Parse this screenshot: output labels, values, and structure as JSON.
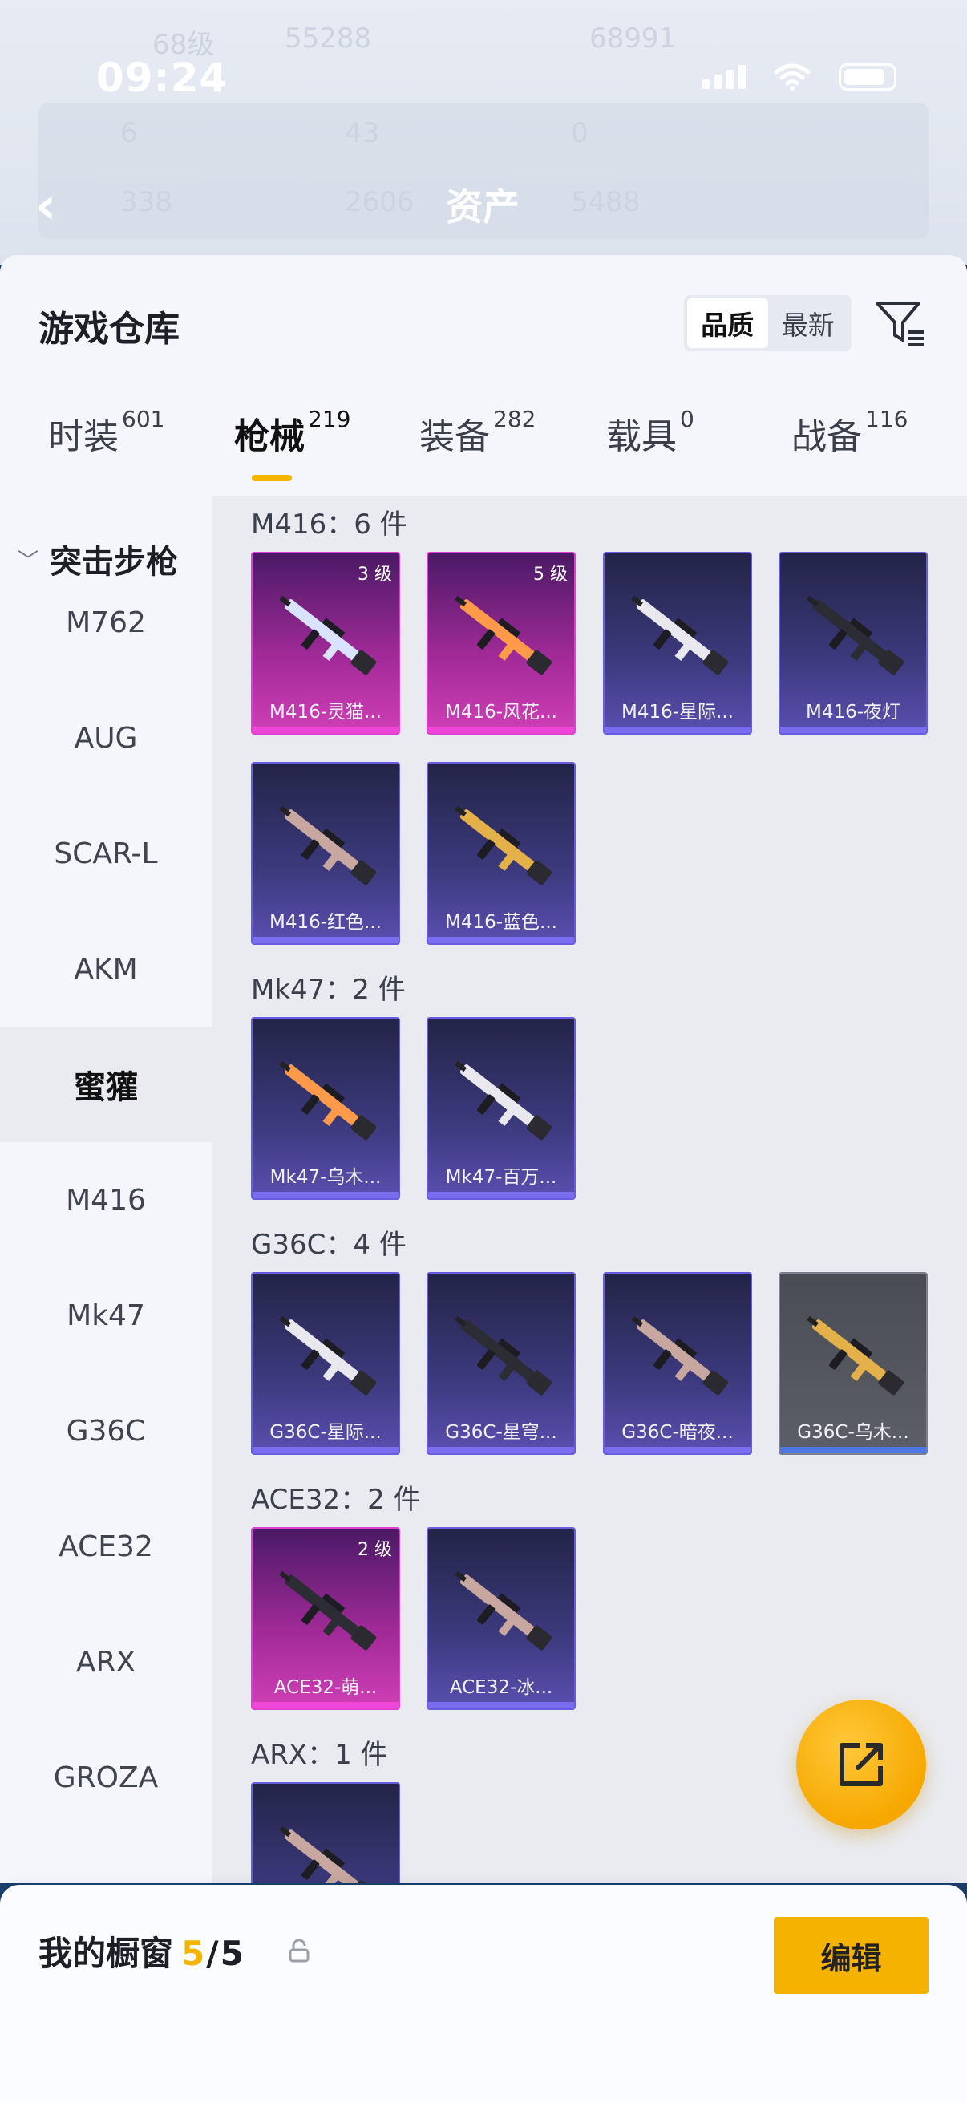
{
  "status_bar": {
    "time": "09:24"
  },
  "background": {
    "title": "资产",
    "ghost_texts": [
      "68级",
      "55288",
      "68991",
      "6",
      "43",
      "0",
      "338",
      "2606",
      "5488"
    ]
  },
  "header": {
    "title": "游戏仓库",
    "sort_options": [
      {
        "label": "品质",
        "active": true
      },
      {
        "label": "最新",
        "active": false
      }
    ],
    "filter_icon": "filter-icon"
  },
  "tabs": [
    {
      "label": "时装",
      "count": "601",
      "active": false
    },
    {
      "label": "枪械",
      "count": "219",
      "active": true
    },
    {
      "label": "装备",
      "count": "282",
      "active": false
    },
    {
      "label": "载具",
      "count": "0",
      "active": false
    },
    {
      "label": "战备",
      "count": "116",
      "active": false
    }
  ],
  "sidebar": {
    "group": "突击步枪",
    "items": [
      "M762",
      "AUG",
      "SCAR-L",
      "AKM",
      "蜜獾",
      "M416",
      "Mk47",
      "G36C",
      "ACE32",
      "ARX",
      "GROZA"
    ],
    "active_item": "蜜獾"
  },
  "sections": [
    {
      "title": "M416：6 件",
      "items": [
        {
          "name": "M416-灵猫...",
          "rarity": "pink",
          "level": "3 级"
        },
        {
          "name": "M416-风花...",
          "rarity": "pink",
          "level": "5 级"
        },
        {
          "name": "M416-星际...",
          "rarity": "purple",
          "level": ""
        },
        {
          "name": "M416-夜灯",
          "rarity": "purple",
          "level": ""
        },
        {
          "name": "M416-红色...",
          "rarity": "purple",
          "level": ""
        },
        {
          "name": "M416-蓝色...",
          "rarity": "purple",
          "level": ""
        }
      ]
    },
    {
      "title": "Mk47：2 件",
      "items": [
        {
          "name": "Mk47-乌木...",
          "rarity": "purple",
          "level": ""
        },
        {
          "name": "Mk47-百万...",
          "rarity": "purple",
          "level": ""
        }
      ]
    },
    {
      "title": "G36C：4 件",
      "items": [
        {
          "name": "G36C-星际...",
          "rarity": "purple",
          "level": ""
        },
        {
          "name": "G36C-星穹...",
          "rarity": "purple",
          "level": ""
        },
        {
          "name": "G36C-暗夜...",
          "rarity": "purple",
          "level": ""
        },
        {
          "name": "G36C-乌木...",
          "rarity": "gray",
          "level": ""
        }
      ]
    },
    {
      "title": "ACE32：2 件",
      "items": [
        {
          "name": "ACE32-萌...",
          "rarity": "pink",
          "level": "2 级"
        },
        {
          "name": "ACE32-冰...",
          "rarity": "purple",
          "level": ""
        }
      ]
    },
    {
      "title": "ARX：1 件",
      "items": [
        {
          "name": "",
          "rarity": "purple",
          "level": ""
        }
      ]
    }
  ],
  "showcase": {
    "label": "我的橱窗",
    "current": "5",
    "total": "5",
    "edit_label": "编辑"
  },
  "colors": {
    "accent": "#f5b400",
    "pink_rarity": "#e23fd0",
    "purple_rarity": "#6a5ce0"
  }
}
